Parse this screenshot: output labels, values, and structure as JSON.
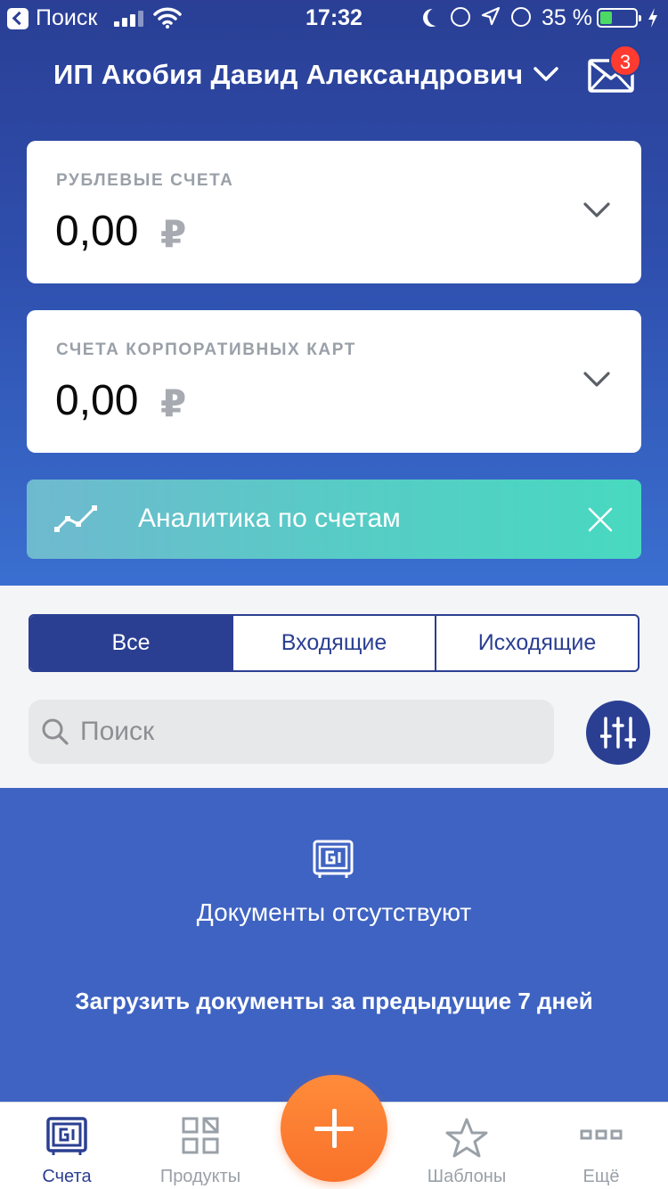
{
  "status_bar": {
    "back_label": "Поиск",
    "time": "17:32",
    "battery_percent": "35 %",
    "battery_level": 0.35
  },
  "header": {
    "company_name": "ИП Акобия Давид Александрович",
    "unread_count": "3"
  },
  "balances": [
    {
      "title": "РУБЛЕВЫЕ СЧЕТА",
      "amount": "0,00",
      "currency": "₽"
    },
    {
      "title": "СЧЕТА КОРПОРАТИВНЫХ КАРТ",
      "amount": "0,00",
      "currency": "₽"
    }
  ],
  "analytics_banner": {
    "label": "Аналитика по счетам",
    "icon": "chart-line-icon"
  },
  "filter_tabs": [
    {
      "label": "Все",
      "active": true
    },
    {
      "label": "Входящие",
      "active": false
    },
    {
      "label": "Исходящие",
      "active": false
    }
  ],
  "search": {
    "placeholder": "Поиск",
    "value": ""
  },
  "documents": {
    "empty_text": "Документы отсутствуют",
    "load_link": "Загрузить документы за предыдущие 7 дней",
    "icon": "safe-icon"
  },
  "tabbar": {
    "items": [
      {
        "label": "Счета",
        "icon": "safe-icon",
        "active": true
      },
      {
        "label": "Продукты",
        "icon": "grid-icon",
        "active": false
      },
      {
        "label": "Шаблоны",
        "icon": "star-icon",
        "active": false
      },
      {
        "label": "Ещё",
        "icon": "more-icon",
        "active": false
      }
    ],
    "fab_icon": "plus-icon"
  },
  "colors": {
    "primary": "#2b3f92",
    "docs_bg": "#3f63c2",
    "accent_orange": "#f9722a",
    "badge_red": "#ff3b30",
    "analytics_teal": "#48d9c0"
  }
}
